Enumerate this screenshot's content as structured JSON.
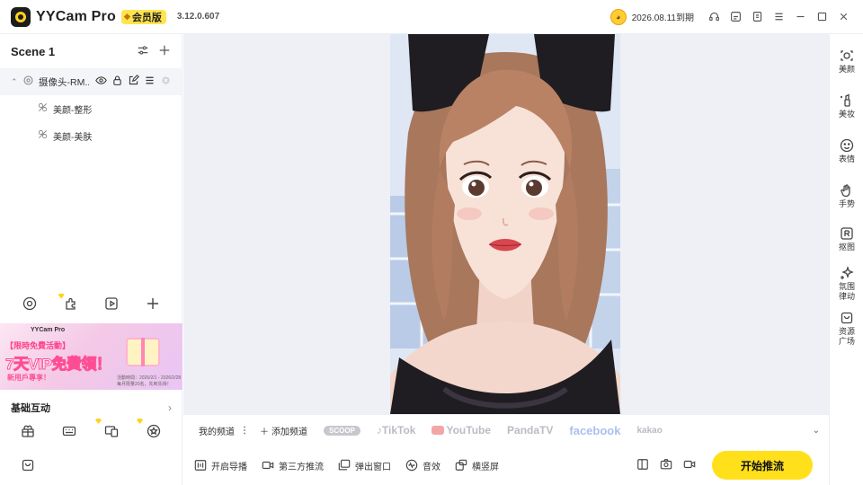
{
  "app": {
    "name": "YYCam Pro",
    "vip_label": "会员版",
    "version": "3.12.0.607",
    "expiry": "2026.08.11到期"
  },
  "scene": {
    "title": "Scene 1",
    "source_name": "摄像头-RM...",
    "sub_items": [
      {
        "label": "美颜-整形"
      },
      {
        "label": "美颜-美肤"
      }
    ]
  },
  "banner": {
    "brand": "YYCam Pro",
    "line1": "【限時免費活動】",
    "headline": "7天VIP免費領！",
    "sub": "新用戶專享！",
    "date_line1": "活動時間：2026/2/1 - 2026/2/28",
    "date_line2": "每月限量20名，先到先得！"
  },
  "basic": {
    "title": "基础互动"
  },
  "channels": {
    "my_channel": "我的频道",
    "add_channel": "添加频道",
    "platforms": [
      "SCOOP",
      "TikTok",
      "YouTube",
      "PandaTV",
      "facebook",
      "kakao"
    ]
  },
  "actions": {
    "guide_stream": "开启导播",
    "third_party": "第三方推流",
    "popup_window": "弹出窗口",
    "sound_effect": "音效",
    "landscape_portrait": "横竖屏",
    "start_stream": "开始推流"
  },
  "rail": {
    "items": [
      {
        "label": "美颜"
      },
      {
        "label": "美妆"
      },
      {
        "label": "表情"
      },
      {
        "label": "手势"
      },
      {
        "label": "抠图"
      },
      {
        "label": "氛围律动"
      },
      {
        "label": "资源广场"
      }
    ]
  },
  "colors": {
    "accent": "#ffe01a",
    "stage_bg": "#eef0f5",
    "banner_pink": "#ff4d94"
  }
}
